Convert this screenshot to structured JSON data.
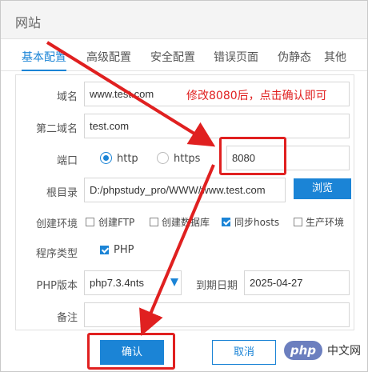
{
  "window": {
    "title": "网站"
  },
  "tabs": [
    {
      "label": "基本配置",
      "active": true
    },
    {
      "label": "高级配置",
      "active": false
    },
    {
      "label": "安全配置",
      "active": false
    },
    {
      "label": "错误页面",
      "active": false
    },
    {
      "label": "伪静态",
      "active": false
    },
    {
      "label": "其他",
      "active": false
    }
  ],
  "form": {
    "domain": {
      "label": "域名",
      "value": "www.test.com"
    },
    "second_domain": {
      "label": "第二域名",
      "value": "test.com"
    },
    "port": {
      "label": "端口",
      "options": [
        "http",
        "https"
      ],
      "selected": "http",
      "value": "8080"
    },
    "root_dir": {
      "label": "根目录",
      "value": "D:/phpstudy_pro/WWW/www.test.com",
      "browse_label": "浏览"
    },
    "env": {
      "label": "创建环境",
      "options": [
        {
          "label": "创建FTP",
          "checked": false
        },
        {
          "label": "创建数据库",
          "checked": false
        },
        {
          "label": "同步hosts",
          "checked": true
        },
        {
          "label": "生产环境",
          "checked": false
        }
      ]
    },
    "program_type": {
      "label": "程序类型",
      "option": "PHP",
      "checked": true
    },
    "php_version": {
      "label": "PHP版本",
      "value": "php7.3.4nts"
    },
    "expire_date": {
      "label": "到期日期",
      "value": "2025-04-27"
    },
    "remark": {
      "label": "备注",
      "value": ""
    }
  },
  "annotation": {
    "text": "修改8080后，点击确认即可",
    "color": "#e02020"
  },
  "buttons": {
    "confirm": "确认",
    "cancel": "取消"
  },
  "watermark": {
    "badge": "php",
    "text": "中文网"
  },
  "colors": {
    "accent": "#1b84d6",
    "annotation": "#e02020"
  }
}
